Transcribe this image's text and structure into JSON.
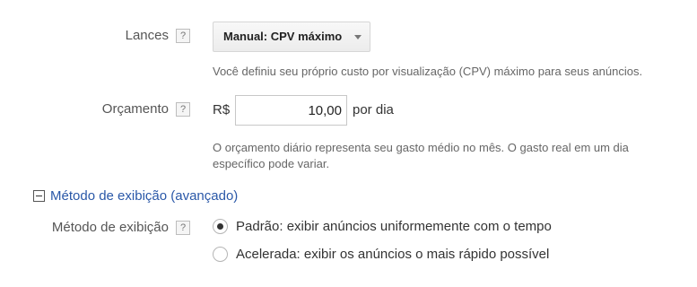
{
  "bidding": {
    "label": "Lances",
    "help_icon": "?",
    "selected_strategy": "Manual: CPV máximo",
    "description": "Você definiu seu próprio custo por visualização (CPV) máximo para seus anúncios."
  },
  "budget": {
    "label": "Orçamento",
    "help_icon": "?",
    "currency": "R$",
    "amount": "10,00",
    "period": "por dia",
    "description_line1": "O orçamento diário representa seu gasto médio no mês. O gasto real em um dia",
    "description_line2": "específico pode variar."
  },
  "delivery_section": {
    "title": "Método de exibição (avançado)",
    "toggle_icon": "minus-square-icon"
  },
  "delivery": {
    "label": "Método de exibição",
    "help_icon": "?",
    "options": [
      {
        "label": "Padrão: exibir anúncios uniformemente com o tempo",
        "selected": true
      },
      {
        "label": "Acelerada: exibir os anúncios o mais rápido possível",
        "selected": false
      }
    ]
  }
}
